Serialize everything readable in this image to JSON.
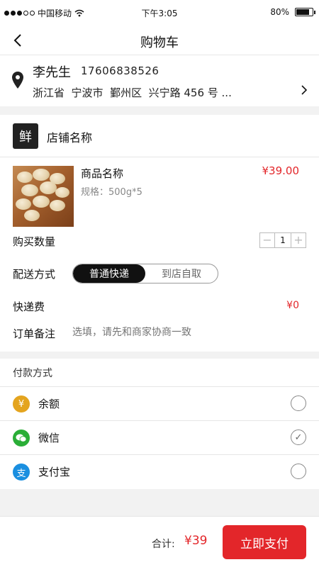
{
  "status": {
    "carrier": "中国移动",
    "time": "下午3:05",
    "battery": "80%",
    "battery_level": 0.8
  },
  "nav": {
    "back_icon": "chevron-left-icon",
    "title": "购物车"
  },
  "address": {
    "icon": "location-pin-icon",
    "name": "李先生",
    "phone": "17606838526",
    "detail": "浙江省  宁波市  鄞州区  兴宁路 456 号 ..."
  },
  "shop": {
    "logo_text": "鲜",
    "name": "店铺名称"
  },
  "product": {
    "name": "商品名称",
    "spec": "规格：500g*5",
    "price": "¥39.00"
  },
  "quantity": {
    "label": "购买数量",
    "minus": "−",
    "value": "1",
    "plus": "+"
  },
  "delivery": {
    "label": "配送方式",
    "options": [
      "普通快递",
      "到店自取"
    ],
    "selected_index": 0
  },
  "fee": {
    "label": "快递费",
    "value": "¥0"
  },
  "note": {
    "label": "订单备注",
    "placeholder": "选填，请先和商家协商一致"
  },
  "payment": {
    "title": "付款方式",
    "methods": [
      {
        "label": "余额",
        "icon": "yuan-icon",
        "color": "#e4a41e",
        "glyph": "¥",
        "selected": false
      },
      {
        "label": "微信",
        "icon": "wechat-icon",
        "color": "#2aae37",
        "glyph": "◍",
        "selected": true
      },
      {
        "label": "支付宝",
        "icon": "alipay-icon",
        "color": "#1a8fe0",
        "glyph": "支",
        "selected": false
      }
    ],
    "check_mark": "✓"
  },
  "footer": {
    "total_label": "合计:",
    "total_value": "¥39",
    "pay_button": "立即支付"
  },
  "colors": {
    "accent": "#e3262a"
  }
}
